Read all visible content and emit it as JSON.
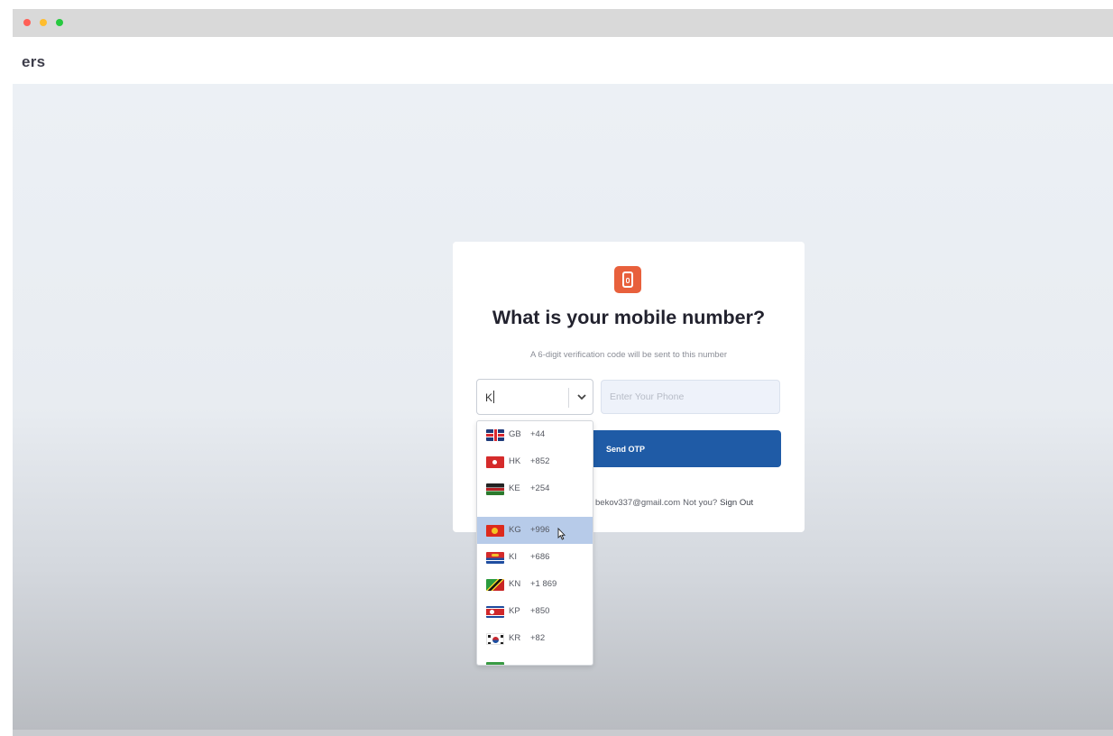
{
  "app": {
    "title_fragment": "ers"
  },
  "logo": {
    "icon": "phone-icon",
    "color": "#e8603c"
  },
  "form": {
    "title": "What is your mobile number?",
    "subtitle": "A 6-digit verification code will be sent to this number",
    "country_search_value": "K",
    "phone_placeholder": "Enter Your Phone",
    "send_button_label": "Send OTP",
    "signed_in_email_fragment": "bekov337@gmail.com",
    "not_you_label": "Not you?",
    "sign_out_label": "Sign Out",
    "accent_color": "#1f5ba6"
  },
  "dropdown": {
    "selected_index": 3,
    "options": [
      {
        "code": "GB",
        "dial": "+44",
        "flag_icon": "uk-flag-icon"
      },
      {
        "code": "HK",
        "dial": "+852",
        "flag_icon": "hong-kong-flag-icon"
      },
      {
        "code": "KE",
        "dial": "+254",
        "flag_icon": "kenya-flag-icon"
      },
      {
        "code": "KG",
        "dial": "+996",
        "flag_icon": "kyrgyzstan-flag-icon"
      },
      {
        "code": "KI",
        "dial": "+686",
        "flag_icon": "kiribati-flag-icon"
      },
      {
        "code": "KN",
        "dial": "+1 869",
        "flag_icon": "saint-kitts-flag-icon"
      },
      {
        "code": "KP",
        "dial": "+850",
        "flag_icon": "north-korea-flag-icon"
      },
      {
        "code": "KR",
        "dial": "+82",
        "flag_icon": "south-korea-flag-icon"
      }
    ]
  }
}
